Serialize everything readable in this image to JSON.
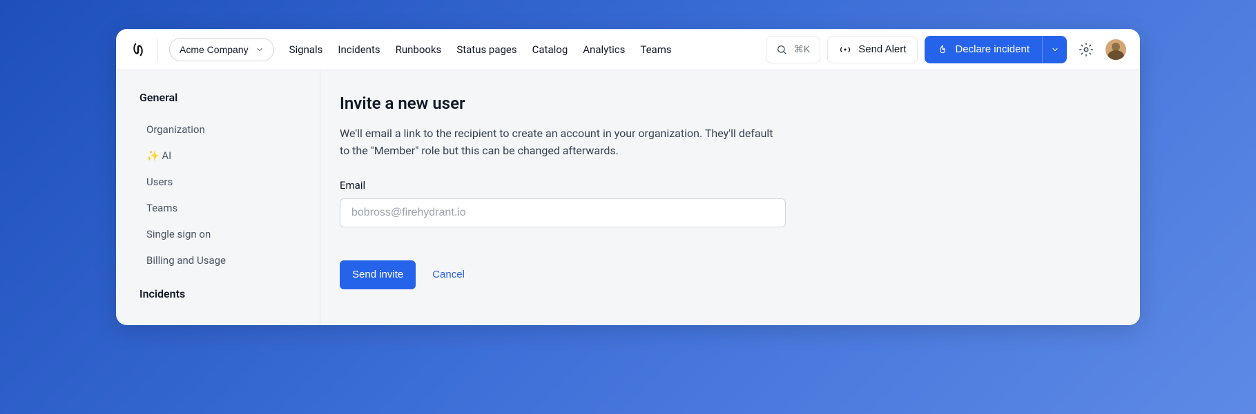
{
  "header": {
    "org_name": "Acme Company",
    "nav": [
      "Signals",
      "Incidents",
      "Runbooks",
      "Status pages",
      "Catalog",
      "Analytics",
      "Teams"
    ],
    "search_shortcut": "⌘K",
    "send_alert_label": "Send Alert",
    "declare_label": "Declare incident"
  },
  "sidebar": {
    "section1_heading": "General",
    "items": [
      "Organization",
      "✨ AI",
      "Users",
      "Teams",
      "Single sign on",
      "Billing and Usage"
    ],
    "section2_heading": "Incidents"
  },
  "main": {
    "title": "Invite a new user",
    "description": "We'll email a link to the recipient to create an account in your organization. They'll default to the \"Member\" role but this can be changed afterwards.",
    "email_label": "Email",
    "email_placeholder": "bobross@firehydrant.io",
    "send_invite_label": "Send invite",
    "cancel_label": "Cancel"
  }
}
